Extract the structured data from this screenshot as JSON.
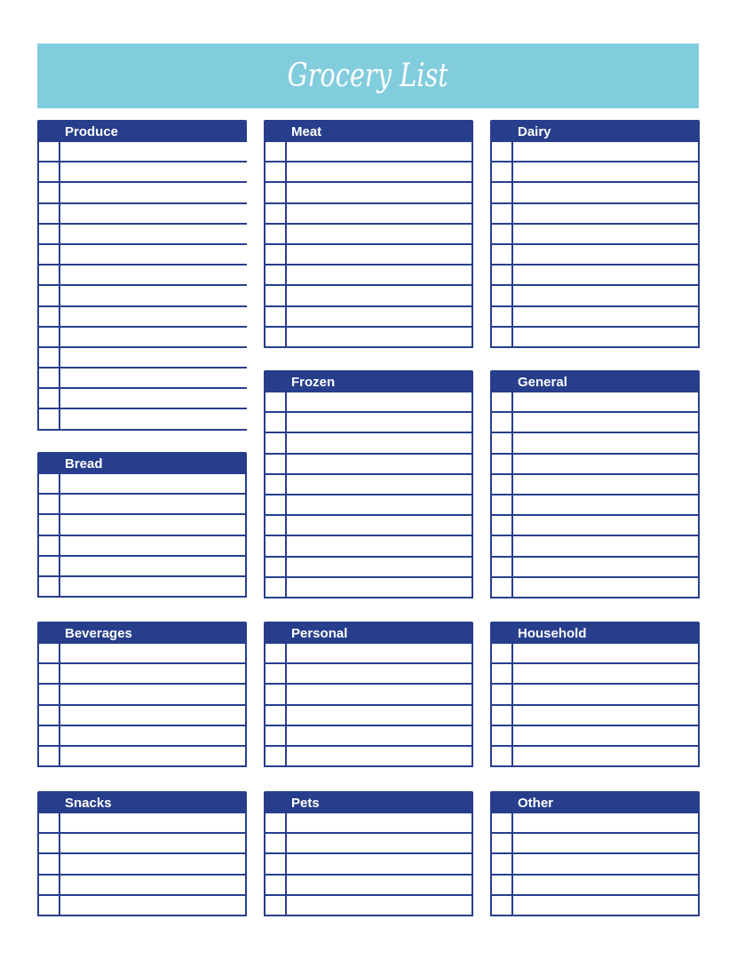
{
  "title": "Grocery List",
  "colors": {
    "banner": "#82cddd",
    "header": "#273e8c",
    "line": "#273e8c"
  },
  "sections": [
    {
      "name": "Produce",
      "rows": 14,
      "items": []
    },
    {
      "name": "Meat",
      "rows": 10,
      "items": []
    },
    {
      "name": "Dairy",
      "rows": 10,
      "items": []
    },
    {
      "name": "Frozen",
      "rows": 10,
      "items": []
    },
    {
      "name": "General",
      "rows": 10,
      "items": []
    },
    {
      "name": "Bread",
      "rows": 6,
      "items": []
    },
    {
      "name": "Beverages",
      "rows": 6,
      "items": []
    },
    {
      "name": "Personal",
      "rows": 6,
      "items": []
    },
    {
      "name": "Household",
      "rows": 6,
      "items": []
    },
    {
      "name": "Snacks",
      "rows": 5,
      "items": []
    },
    {
      "name": "Pets",
      "rows": 5,
      "items": []
    },
    {
      "name": "Other",
      "rows": 5,
      "items": []
    }
  ]
}
